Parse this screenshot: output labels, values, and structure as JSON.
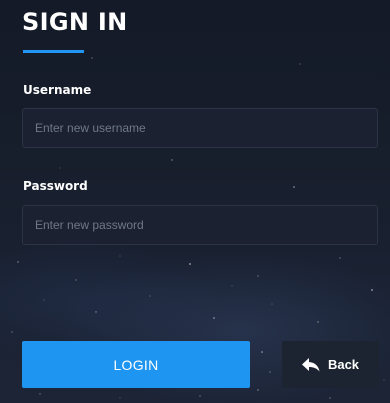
{
  "form": {
    "title": "SIGN IN",
    "accent_color": "#2196f3",
    "username": {
      "label": "Username",
      "placeholder": "Enter new username",
      "value": ""
    },
    "password": {
      "label": "Password",
      "placeholder": "Enter new password",
      "value": ""
    }
  },
  "actions": {
    "login_label": "LOGIN",
    "back_label": "Back",
    "back_icon": "reply-arrow-icon"
  }
}
